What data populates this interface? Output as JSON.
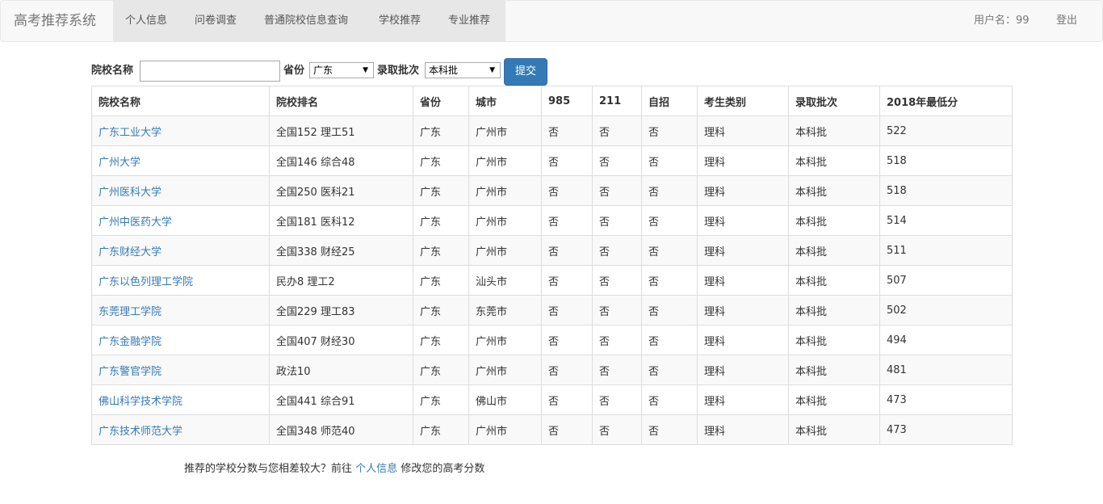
{
  "navbar": {
    "brand": "高考推荐系统",
    "items": [
      "个人信息",
      "问卷调查",
      "普通院校信息查询",
      "学校推荐",
      "专业推荐"
    ],
    "user_label": "用户名：99",
    "logout": "登出"
  },
  "form": {
    "school_label": "院校名称",
    "school_value": "",
    "province_label": "省份",
    "province_value": "广东",
    "batch_label": "录取批次",
    "batch_value": "本科批",
    "submit": "提交"
  },
  "table": {
    "headers": [
      "院校名称",
      "院校排名",
      "省份",
      "城市",
      "985",
      "211",
      "自招",
      "考生类别",
      "录取批次",
      "2018年最低分"
    ],
    "rows": [
      [
        "广东工业大学",
        "全国152 理工51",
        "广东",
        "广州市",
        "否",
        "否",
        "否",
        "理科",
        "本科批",
        "522"
      ],
      [
        "广州大学",
        "全国146 综合48",
        "广东",
        "广州市",
        "否",
        "否",
        "否",
        "理科",
        "本科批",
        "518"
      ],
      [
        "广州医科大学",
        "全国250 医科21",
        "广东",
        "广州市",
        "否",
        "否",
        "否",
        "理科",
        "本科批",
        "518"
      ],
      [
        "广州中医药大学",
        "全国181 医科12",
        "广东",
        "广州市",
        "否",
        "否",
        "否",
        "理科",
        "本科批",
        "514"
      ],
      [
        "广东财经大学",
        "全国338 财经25",
        "广东",
        "广州市",
        "否",
        "否",
        "否",
        "理科",
        "本科批",
        "511"
      ],
      [
        "广东以色列理工学院",
        "民办8 理工2",
        "广东",
        "汕头市",
        "否",
        "否",
        "否",
        "理科",
        "本科批",
        "507"
      ],
      [
        "东莞理工学院",
        "全国229 理工83",
        "广东",
        "东莞市",
        "否",
        "否",
        "否",
        "理科",
        "本科批",
        "502"
      ],
      [
        "广东金融学院",
        "全国407 财经30",
        "广东",
        "广州市",
        "否",
        "否",
        "否",
        "理科",
        "本科批",
        "494"
      ],
      [
        "广东警官学院",
        "政法10",
        "广东",
        "广州市",
        "否",
        "否",
        "否",
        "理科",
        "本科批",
        "481"
      ],
      [
        "佛山科学技术学院",
        "全国441 综合91",
        "广东",
        "佛山市",
        "否",
        "否",
        "否",
        "理科",
        "本科批",
        "473"
      ],
      [
        "广东技术师范大学",
        "全国348 师范40",
        "广东",
        "广州市",
        "否",
        "否",
        "否",
        "理科",
        "本科批",
        "473"
      ]
    ]
  },
  "footer": {
    "prefix": "推荐的学校分数与您相差较大？前往",
    "link": "个人信息",
    "suffix": "修改您的高考分数"
  }
}
